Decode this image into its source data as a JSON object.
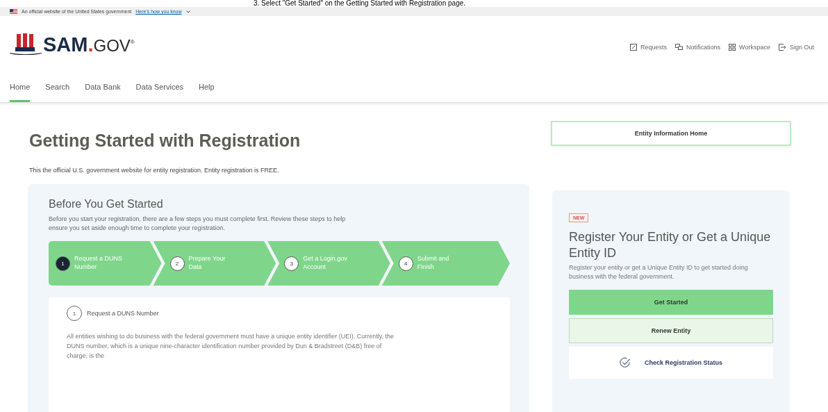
{
  "caption": "3.  Select \"Get Started\" on the Getting Started with Registration page.",
  "gov_banner": {
    "text": "An official website of the United States government",
    "link": "Here's how you know"
  },
  "header": {
    "logo": {
      "bold": "SAM",
      "dot": ".",
      "light": "GOV",
      "mark": "®"
    },
    "links": [
      {
        "kind": "requests",
        "label": "Requests"
      },
      {
        "kind": "notifications",
        "label": "Notifications"
      },
      {
        "kind": "workspace",
        "label": "Workspace"
      },
      {
        "kind": "signout",
        "label": "Sign Out"
      }
    ]
  },
  "nav": [
    {
      "label": "Home",
      "selected": true
    },
    {
      "label": "Search",
      "selected": false
    },
    {
      "label": "Data Bank",
      "selected": false
    },
    {
      "label": "Data Services",
      "selected": false
    },
    {
      "label": "Help",
      "selected": false
    }
  ],
  "page": {
    "title": "Getting Started with Registration",
    "subtitle": "This the official U.S. government website for entity registration. Entity registration is FREE."
  },
  "before": {
    "title": "Before You Get Started",
    "text": "Before you start your registration, there are a few steps you must complete first. Review these steps to help ensure you set aside enough time to complete your registration.",
    "steps": [
      {
        "number": "1",
        "label": "Request a DUNS Number",
        "selected": true
      },
      {
        "number": "2",
        "label": "Prepare Your Data",
        "selected": false
      },
      {
        "number": "3",
        "label": "Get a Login.gov Account",
        "selected": false
      },
      {
        "number": "4",
        "label": "Submit and Finish",
        "selected": false
      }
    ],
    "detail": {
      "number": "1",
      "title": "Request a DUNS Number",
      "text": "All entities wishing to do business with the federal government must have a unique entity identifier (UEI). Currently, the DUNS number, which is a unique nine-character identification number provided by Dun & Bradstreet (D&B) free of charge, is the"
    }
  },
  "side": {
    "top_button": "Entity Information Home",
    "badge": "NEW",
    "title": "Register Your Entity or Get a Unique Entity ID",
    "text": "Register your entity or get a Unique Entity ID to get started doing business with the federal government.",
    "buttons": [
      {
        "kind": "primary",
        "label": "Get Started"
      },
      {
        "kind": "secondary",
        "label": "Renew Entity"
      },
      {
        "kind": "status",
        "label": "Check Registration Status"
      }
    ]
  }
}
